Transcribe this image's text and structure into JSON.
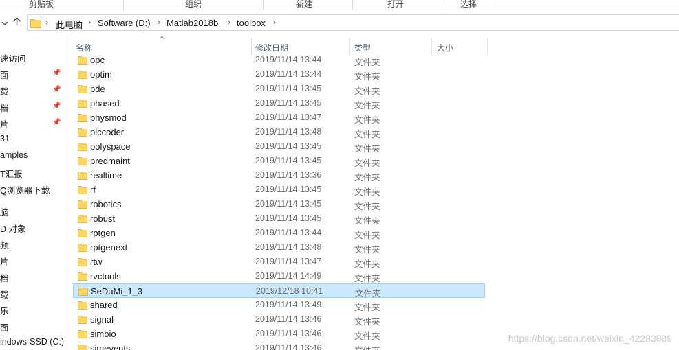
{
  "ribbon": {
    "groups": [
      "剪贴板",
      "组织",
      "新建",
      "打开",
      "选择"
    ]
  },
  "nav": {
    "back_icon": "chevron-down-icon",
    "up_icon": "up-arrow-icon"
  },
  "address": {
    "crumbs": [
      "此电脑",
      "Software (D:)",
      "Matlab2018b",
      "toolbox"
    ]
  },
  "sidebar": {
    "items": [
      {
        "label": "速访问",
        "pinned": false
      },
      {
        "label": "面",
        "pinned": true
      },
      {
        "label": "载",
        "pinned": true
      },
      {
        "label": "档",
        "pinned": true
      },
      {
        "label": "片",
        "pinned": true
      },
      {
        "label": "31",
        "pinned": false
      },
      {
        "label": "amples",
        "pinned": false
      },
      {
        "label": "T汇报",
        "pinned": false
      },
      {
        "label": "Q浏览器下载",
        "pinned": false
      },
      {
        "label": "脑",
        "pinned": false
      },
      {
        "label": "D 对象",
        "pinned": false
      },
      {
        "label": "频",
        "pinned": false
      },
      {
        "label": "片",
        "pinned": false
      },
      {
        "label": "档",
        "pinned": false
      },
      {
        "label": "载",
        "pinned": false
      },
      {
        "label": "乐",
        "pinned": false
      },
      {
        "label": "面",
        "pinned": false
      },
      {
        "label": "indows-SSD (C:)",
        "pinned": false
      }
    ]
  },
  "columns": {
    "name": "名称",
    "date": "修改日期",
    "type": "类型",
    "size": "大小"
  },
  "files": [
    {
      "name": "opc",
      "date": "2019/11/14 13:44",
      "type": "文件夹",
      "selected": false
    },
    {
      "name": "optim",
      "date": "2019/11/14 13:44",
      "type": "文件夹",
      "selected": false
    },
    {
      "name": "pde",
      "date": "2019/11/14 13:45",
      "type": "文件夹",
      "selected": false
    },
    {
      "name": "phased",
      "date": "2019/11/14 13:45",
      "type": "文件夹",
      "selected": false
    },
    {
      "name": "physmod",
      "date": "2019/11/14 13:47",
      "type": "文件夹",
      "selected": false
    },
    {
      "name": "plccoder",
      "date": "2019/11/14 13:48",
      "type": "文件夹",
      "selected": false
    },
    {
      "name": "polyspace",
      "date": "2019/11/14 13:45",
      "type": "文件夹",
      "selected": false
    },
    {
      "name": "predmaint",
      "date": "2019/11/14 13:45",
      "type": "文件夹",
      "selected": false
    },
    {
      "name": "realtime",
      "date": "2019/11/14 13:36",
      "type": "文件夹",
      "selected": false
    },
    {
      "name": "rf",
      "date": "2019/11/14 13:45",
      "type": "文件夹",
      "selected": false
    },
    {
      "name": "robotics",
      "date": "2019/11/14 13:45",
      "type": "文件夹",
      "selected": false
    },
    {
      "name": "robust",
      "date": "2019/11/14 13:45",
      "type": "文件夹",
      "selected": false
    },
    {
      "name": "rptgen",
      "date": "2019/11/14 13:44",
      "type": "文件夹",
      "selected": false
    },
    {
      "name": "rptgenext",
      "date": "2019/11/14 13:48",
      "type": "文件夹",
      "selected": false
    },
    {
      "name": "rtw",
      "date": "2019/11/14 13:47",
      "type": "文件夹",
      "selected": false
    },
    {
      "name": "rvctools",
      "date": "2019/11/14 14:49",
      "type": "文件夹",
      "selected": false
    },
    {
      "name": "SeDuMi_1_3",
      "date": "2019/12/18 10:41",
      "type": "文件夹",
      "selected": true
    },
    {
      "name": "shared",
      "date": "2019/11/14 13:49",
      "type": "文件夹",
      "selected": false
    },
    {
      "name": "signal",
      "date": "2019/11/14 13:46",
      "type": "文件夹",
      "selected": false
    },
    {
      "name": "simbio",
      "date": "2019/11/14 13:46",
      "type": "文件夹",
      "selected": false
    },
    {
      "name": "simevents",
      "date": "2019/11/14 13:46",
      "type": "文件夹",
      "selected": false
    }
  ],
  "watermark": "https://blog.csdn.net/weixin_42283889",
  "colors": {
    "selection_bg": "#cce8ff",
    "selection_border": "#99d1ff",
    "folder_yellow": "#ffd766",
    "header_text": "#4c607a"
  }
}
